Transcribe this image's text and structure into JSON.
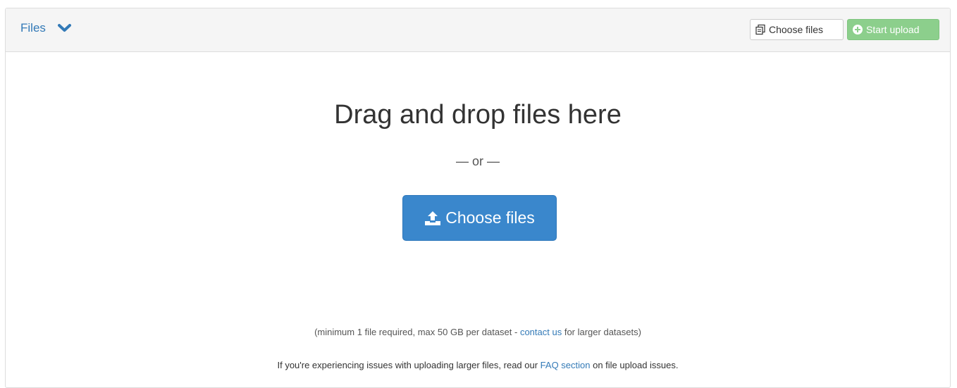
{
  "header": {
    "files_label": "Files",
    "choose_files_small_label": "Choose files",
    "start_upload_label": "Start upload"
  },
  "dropzone": {
    "title": "Drag and drop files here",
    "or_text": "— or —",
    "choose_files_label": "Choose files"
  },
  "notes": {
    "limits_prefix": "(minimum 1 file required, max 50 GB per dataset - ",
    "contact_link": "contact us",
    "limits_suffix": " for larger datasets)",
    "issues_prefix": "If you're experiencing issues with uploading larger files, read our ",
    "faq_link": "FAQ section",
    "issues_suffix": " on file upload issues."
  },
  "colors": {
    "link": "#337ab7",
    "primary_button": "#3a87cc",
    "success_button": "#8ccf8c"
  },
  "icons": {
    "chevron": "chevron-down-icon",
    "copy": "copy-files-icon",
    "plus_circle": "plus-circle-icon",
    "upload": "upload-icon"
  }
}
